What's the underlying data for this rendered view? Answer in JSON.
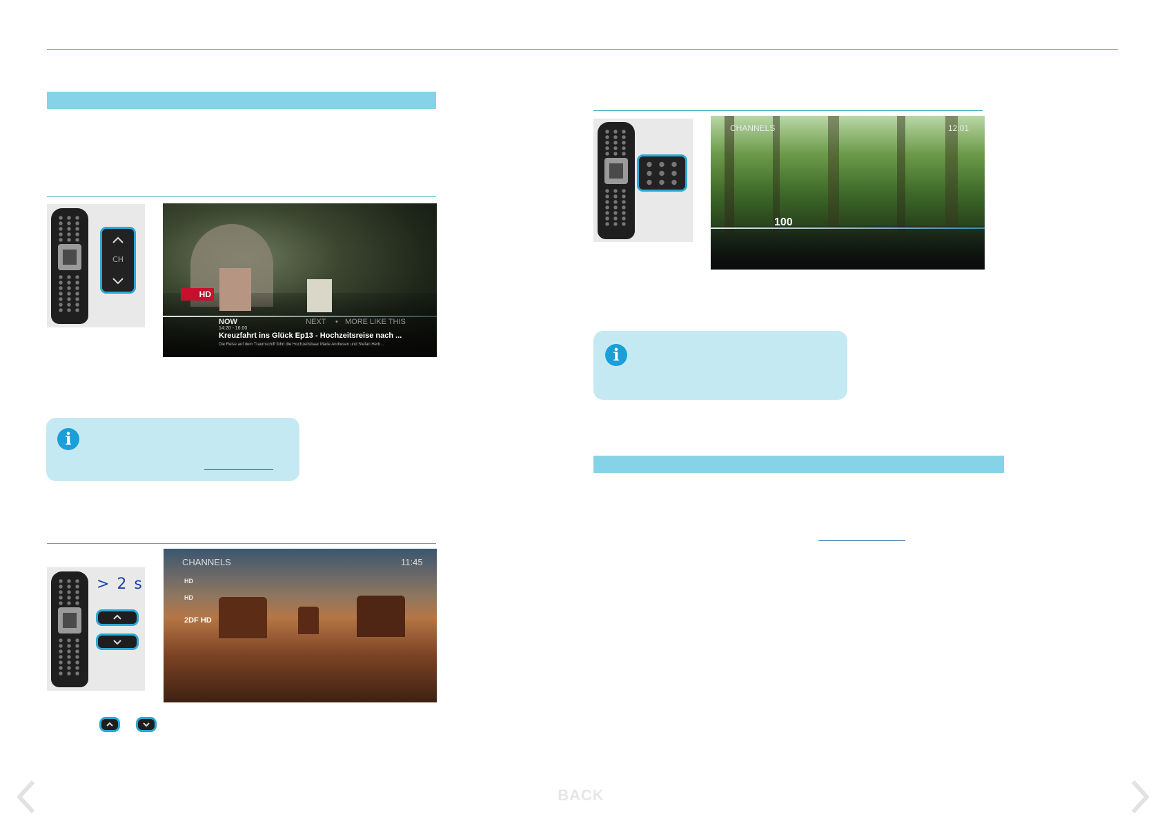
{
  "section_left": {
    "remote1": {
      "ch_label": "CH"
    },
    "tv1": {
      "now_label": "NOW",
      "next_label": "NEXT",
      "separator": "•",
      "more_label": "MORE LIKE THIS",
      "time": "14:20 - 16:00",
      "title": "Kreuzfahrt ins Glück  Ep13 - Hochzeitsreise nach ...",
      "desc": "Die Reise auf dem Traumschiff führt die Hochzeitsbaar Marie Andresen und Stefan Herb...",
      "channel_logo": "HD"
    },
    "remote2": {
      "hold_label": "> 2 s"
    },
    "tv2": {
      "header": "CHANNELS",
      "time": "11:45",
      "channels": [
        "HD",
        "HD",
        "2DF HD"
      ]
    }
  },
  "section_right": {
    "tv3": {
      "header": "CHANNELS",
      "time": "12:01",
      "channel_number": "100"
    }
  },
  "footer": {
    "back_label": "BACK"
  },
  "colors": {
    "accent": "#29a9d6",
    "bar": "#86d3e8",
    "info_bg": "#c5e9f3",
    "icon": "#1a9fd8"
  },
  "icons": [
    "info-icon",
    "chevron-up-icon",
    "chevron-down-icon",
    "chevron-left-icon",
    "chevron-right-icon"
  ]
}
